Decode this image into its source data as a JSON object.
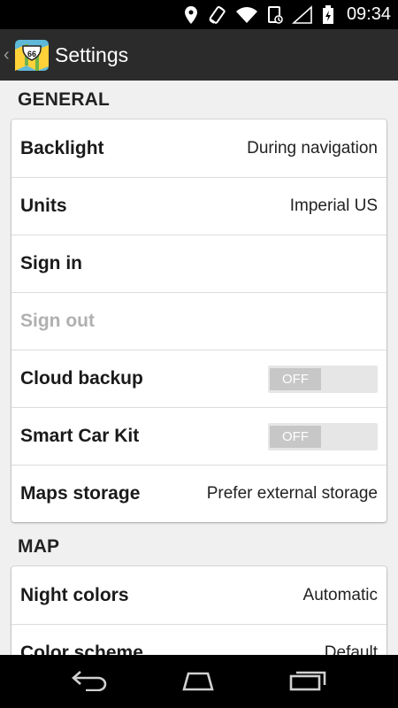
{
  "status_bar": {
    "icons": [
      "location-icon",
      "rotation-icon",
      "wifi-icon",
      "notification-icon",
      "signal-icon",
      "battery-icon"
    ],
    "time": "09:34"
  },
  "action_bar": {
    "back_caret": "‹",
    "title": "Settings",
    "app_icon_text": "66"
  },
  "sections": {
    "general": {
      "header": "GENERAL",
      "backlight": {
        "label": "Backlight",
        "value": "During navigation"
      },
      "units": {
        "label": "Units",
        "value": "Imperial US"
      },
      "sign_in": {
        "label": "Sign in"
      },
      "sign_out": {
        "label": "Sign out"
      },
      "cloud_backup": {
        "label": "Cloud backup",
        "toggle": "OFF"
      },
      "smart_car_kit": {
        "label": "Smart Car Kit",
        "toggle": "OFF"
      },
      "maps_storage": {
        "label": "Maps storage",
        "value": "Prefer external storage"
      }
    },
    "map": {
      "header": "MAP",
      "night_colors": {
        "label": "Night colors",
        "value": "Automatic"
      },
      "color_scheme": {
        "label": "Color scheme",
        "value": "Default"
      }
    }
  },
  "nav_bar": {
    "buttons": [
      "back-icon",
      "home-icon",
      "recents-icon"
    ]
  },
  "colors": {
    "status_bar": "#000000",
    "action_bar": "#2b2b2b",
    "background": "#f0f0f0",
    "card": "#ffffff",
    "disabled_text": "#b0b0b0"
  }
}
